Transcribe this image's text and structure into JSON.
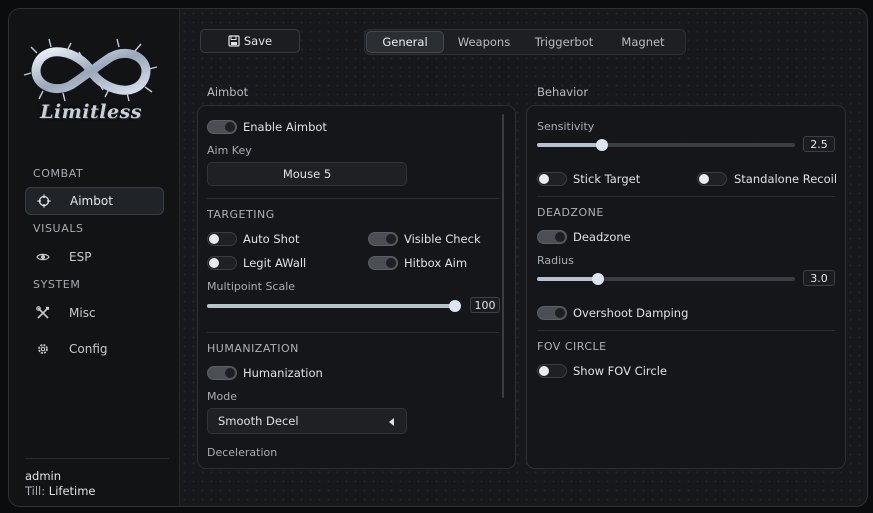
{
  "brand": {
    "logo_text": "Limitless"
  },
  "sidebar": {
    "sections": [
      {
        "label": "COMBAT",
        "items": [
          {
            "label": "Aimbot",
            "icon": "crosshair-icon",
            "active": true
          }
        ]
      },
      {
        "label": "VISUALS",
        "items": [
          {
            "label": "ESP",
            "icon": "eye-icon",
            "active": false
          }
        ]
      },
      {
        "label": "SYSTEM",
        "items": [
          {
            "label": "Misc",
            "icon": "tools-icon",
            "active": false
          },
          {
            "label": "Config",
            "icon": "gear-icon",
            "active": false
          }
        ]
      }
    ],
    "user": {
      "name": "admin",
      "till_label": "Till:",
      "till_value": "Lifetime"
    }
  },
  "toolbar": {
    "save_label": "Save",
    "save_icon": "floppy-disk-icon"
  },
  "tabs": [
    {
      "label": "General",
      "active": true
    },
    {
      "label": "Weapons",
      "active": false
    },
    {
      "label": "Triggerbot",
      "active": false
    },
    {
      "label": "Magnet",
      "active": false
    }
  ],
  "aimbot_panel": {
    "title": "Aimbot",
    "enable_aimbot": {
      "label": "Enable Aimbot",
      "on": true
    },
    "aim_key": {
      "label": "Aim Key",
      "value": "Mouse 5"
    },
    "targeting": {
      "header": "TARGETING",
      "auto_shot": {
        "label": "Auto Shot",
        "on": false
      },
      "visible_check": {
        "label": "Visible Check",
        "on": true
      },
      "legit_awall": {
        "label": "Legit AWall",
        "on": false
      },
      "hitbox_aim": {
        "label": "Hitbox Aim",
        "on": true
      },
      "multipoint_scale": {
        "label": "Multipoint Scale",
        "value": "100",
        "fraction": 1.0
      }
    },
    "humanization": {
      "header": "HUMANIZATION",
      "humanization": {
        "label": "Humanization",
        "on": true
      },
      "mode": {
        "label": "Mode",
        "value": "Smooth Decel"
      },
      "deceleration": {
        "label": "Deceleration"
      }
    }
  },
  "behavior_panel": {
    "title": "Behavior",
    "sensitivity": {
      "label": "Sensitivity",
      "value": "2.5",
      "fraction": 0.25
    },
    "stick_target": {
      "label": "Stick Target",
      "on": false
    },
    "standalone_recoil": {
      "label": "Standalone Recoil",
      "on": false
    },
    "deadzone_section": {
      "header": "DEADZONE",
      "deadzone": {
        "label": "Deadzone",
        "on": true
      },
      "radius": {
        "label": "Radius",
        "value": "3.0",
        "fraction": 0.235
      },
      "overshoot_damping": {
        "label": "Overshoot Damping",
        "on": true
      }
    },
    "fov_section": {
      "header": "FOV CIRCLE",
      "show_fov_circle": {
        "label": "Show FOV Circle",
        "on": false
      }
    }
  },
  "colors": {
    "accent": "#b8c2cf",
    "panel_bg": "#16181b",
    "sidebar_bg": "#111315"
  }
}
